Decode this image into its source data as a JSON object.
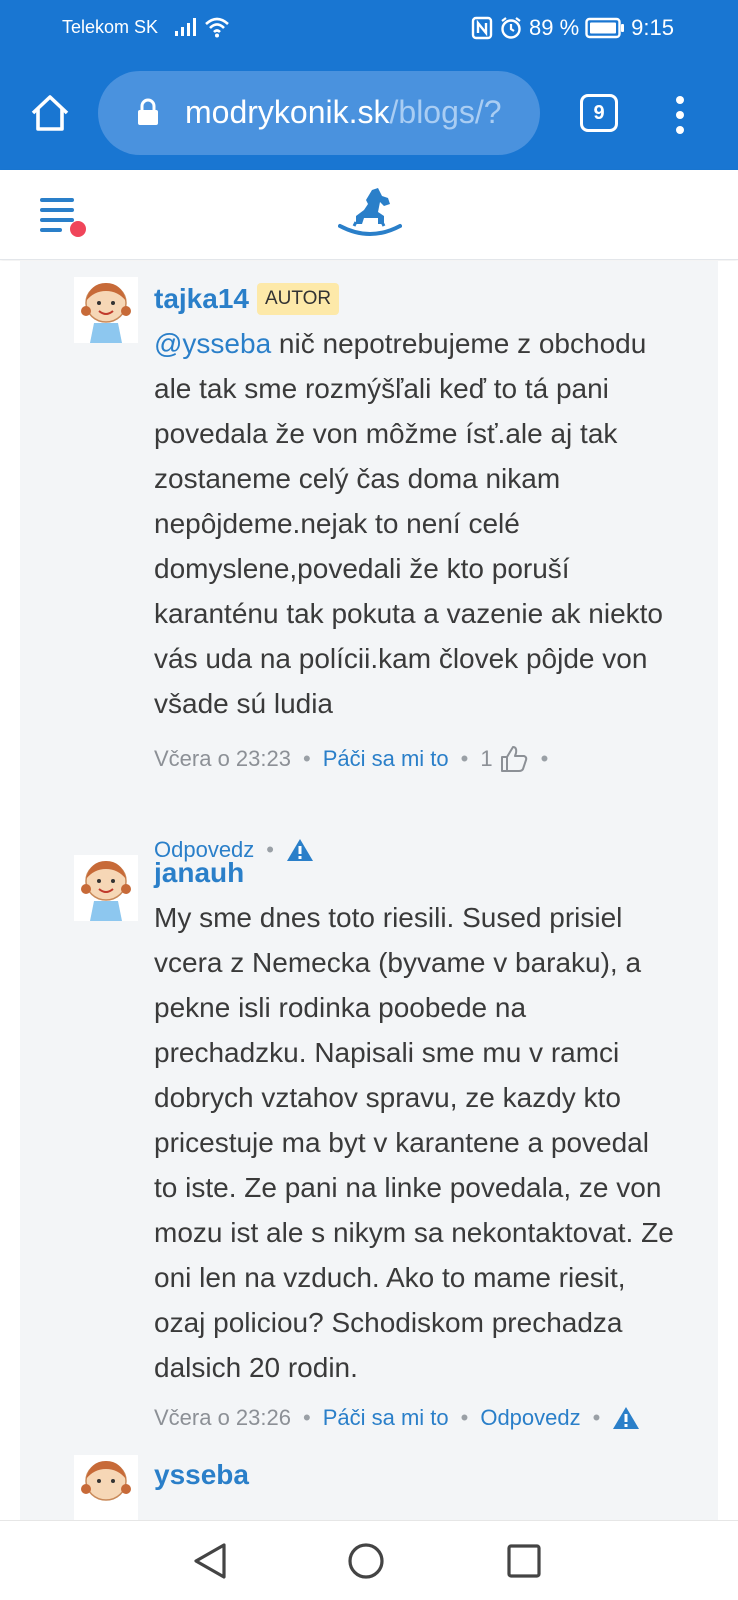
{
  "status_bar": {
    "carrier": "Telekom SK",
    "battery": "89 %",
    "time": "9:15"
  },
  "browser": {
    "url_host": "modrykonik.sk",
    "url_path": "/blogs/?",
    "tab_count": "9"
  },
  "comments": [
    {
      "author": "tajka14",
      "badge": "AUTOR",
      "mention": "@ysseba",
      "text": " nič nepotrebujeme z obchodu ale tak sme rozmýšľali keď to tá pani povedala že von môžme ísť.ale aj tak zostaneme celý čas doma nikam nepôjdeme.nejak to není celé domyslene,povedali že kto poruší karanténu tak pokuta a vazenie ak niekto vás uda na polícii.kam človek pôjde von všade sú ludia",
      "time": "Včera o 23:23",
      "like_label": "Páči sa mi to",
      "likes": "1",
      "reply_label": "Odpovedz"
    },
    {
      "author": "janauh",
      "text": "My sme dnes toto riesili. Sused prisiel vcera z Nemecka (byvame v baraku), a pekne isli rodinka poobede na prechadzku. Napisali sme mu v ramci dobrych vztahov spravu, ze kazdy kto pricestuje ma byt v karantene a povedal to iste. Ze pani na linke povedala, ze von mozu ist ale s nikym sa nekontaktovat. Ze oni len na vzduch. Ako to mame riesit, ozaj policiou? Schodiskom prechadza dalsich 20 rodin.",
      "time": "Včera o 23:26",
      "like_label": "Páči sa mi to",
      "reply_label": "Odpovedz"
    },
    {
      "author": "ysseba"
    }
  ],
  "icons": {
    "home": "home-icon",
    "lock": "lock-icon",
    "menu": "more-vert-icon",
    "hamburger": "hamburger-menu-icon",
    "logo": "rocking-horse-logo",
    "like": "thumbs-up-icon",
    "report": "warning-icon"
  },
  "colors": {
    "brand_blue": "#1976d2",
    "link_blue": "#2a7fc9",
    "notification_dot": "#f0455a",
    "author_badge": "#fde9a9"
  }
}
